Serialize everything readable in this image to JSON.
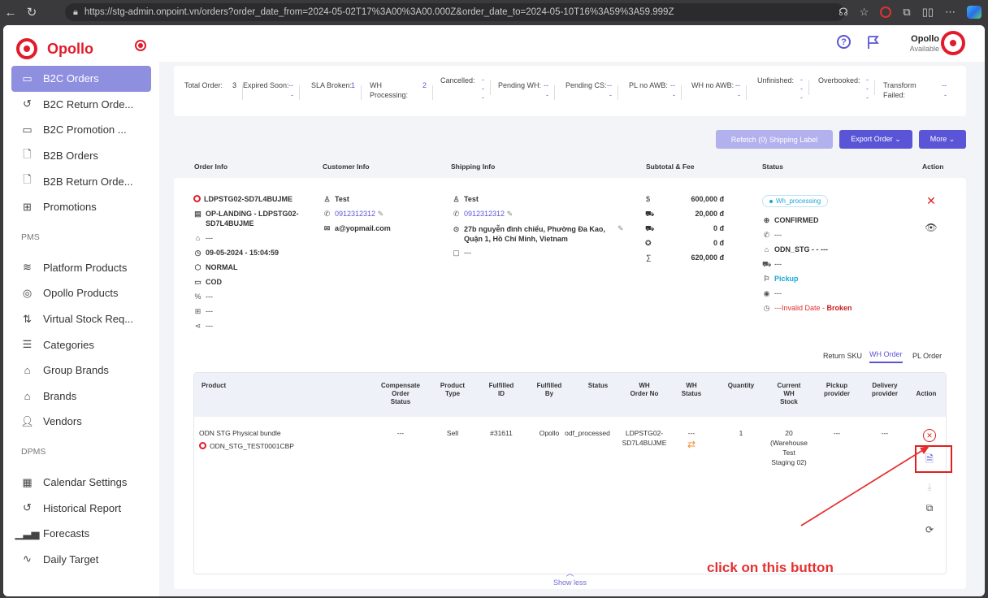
{
  "browser": {
    "url": "https://stg-admin.onpoint.vn/orders?order_date_from=2024-05-02T17%3A00%3A00.000Z&order_date_to=2024-05-10T16%3A59%3A59.999Z"
  },
  "brand": {
    "name": "Opollo"
  },
  "sidebar": {
    "items": [
      {
        "label": "B2C Orders",
        "icon": "orders-icon",
        "active": true
      },
      {
        "label": "B2C Return Orde...",
        "icon": "return-icon"
      },
      {
        "label": "B2C Promotion ...",
        "icon": "promotion-icon"
      },
      {
        "label": "B2B Orders",
        "icon": "document-icon"
      },
      {
        "label": "B2B Return Orde...",
        "icon": "document-icon"
      },
      {
        "label": "Promotions",
        "icon": "table-icon"
      }
    ],
    "pms_label": "PMS",
    "pms_items": [
      {
        "label": "Platform Products",
        "icon": "layers-icon"
      },
      {
        "label": "Opollo Products",
        "icon": "target-icon"
      },
      {
        "label": "Virtual Stock Req...",
        "icon": "flow-icon"
      },
      {
        "label": "Categories",
        "icon": "database-icon"
      },
      {
        "label": "Group Brands",
        "icon": "home-icon"
      },
      {
        "label": "Brands",
        "icon": "home-icon"
      },
      {
        "label": "Vendors",
        "icon": "user-plus-icon"
      }
    ],
    "dpms_label": "DPMS",
    "dpms_items": [
      {
        "label": "Calendar Settings",
        "icon": "calendar-icon"
      },
      {
        "label": "Historical Report",
        "icon": "history-icon"
      },
      {
        "label": "Forecasts",
        "icon": "bar-chart-icon"
      },
      {
        "label": "Daily Target",
        "icon": "activity-icon"
      }
    ]
  },
  "header": {
    "user_name": "Opollo",
    "user_status": "Available"
  },
  "stats": [
    {
      "label": "Total Order:",
      "value": "3",
      "dark": true
    },
    {
      "label": "Expired Soon:",
      "value": "--\n-"
    },
    {
      "label": "SLA Broken:",
      "value": "1"
    },
    {
      "label": "WH Processing:",
      "value": "2"
    },
    {
      "label": "Cancelled:",
      "value": "-\n-\n-"
    },
    {
      "label": "Pending WH:",
      "value": "--\n-"
    },
    {
      "label": "Pending CS:",
      "value": "--\n-"
    },
    {
      "label": "PL no AWB:",
      "value": "--\n-"
    },
    {
      "label": "WH no AWB:",
      "value": "--\n-"
    },
    {
      "label": "Unfinished:",
      "value": "-\n-\n-"
    },
    {
      "label": "Overbooked:",
      "value": "-\n-\n-"
    },
    {
      "label": "Transform Failed:",
      "value": "--\n-"
    }
  ],
  "toolbar": {
    "refetch_label": "Refetch (0) Shipping Label",
    "export_label": "Export Order ⌄",
    "more_label": "More ⌄"
  },
  "columns": {
    "order_info": "Order Info",
    "customer_info": "Customer Info",
    "shipping_info": "Shipping Info",
    "subtotal": "Subtotal & Fee",
    "status": "Status",
    "action": "Action"
  },
  "order": {
    "id": "LDPSTG02-SD7L4BUJME",
    "channel_line1": "OP-LANDING - LDPSTG02-",
    "channel_line2": "SD7L4BUJME",
    "store": "---",
    "date": "09-05-2024 - 15:04:59",
    "type": "NORMAL",
    "payment": "COD",
    "discount": "---",
    "gift": "---",
    "share": "---",
    "customer_name": "Test",
    "customer_phone": "0912312312",
    "customer_email": "a@yopmail.com",
    "shipping_name": "Test",
    "shipping_phone": "0912312312",
    "shipping_address_1": "27b nguyễn đình chiểu, Phường Đa Kao,",
    "shipping_address_2": "Quận 1, Hồ Chí Minh, Vietnam",
    "shipping_note": "---",
    "subtotal": "600,000 đ",
    "shipping_fee": "20,000 đ",
    "fee_2": "0 đ",
    "fee_3": "0 đ",
    "total": "620,000 đ",
    "status_badge": "Wh_processing",
    "status_confirmed": "CONFIRMED",
    "status_line_1": "---",
    "status_wh": "ODN_STG -  - ---",
    "status_line_3": "---",
    "status_pickup": "Pickup",
    "status_line_5": "---",
    "status_invalid": "---Invalid Date - ",
    "status_broken": "Broken"
  },
  "tabs": {
    "return_sku": "Return SKU",
    "wh_order": "WH Order",
    "pl_order": "PL Order"
  },
  "product_table": {
    "headers": {
      "product": "Product",
      "compensate": "Compensate\nOrder\nStatus",
      "ptype": "Product\nType",
      "fulfilled_id": "Fulfilled\nID",
      "fulfilled_by": "Fulfilled\nBy",
      "status": "Status",
      "wh_order_no": "WH\nOrder No",
      "wh_status": "WH\nStatus",
      "quantity": "Quantity",
      "current_stock": "Current\nWH\nStock",
      "pickup": "Pickup\nprovider",
      "delivery": "Delivery\nprovider",
      "action": "Action"
    },
    "row": {
      "product_name": "ODN STG Physical bundle",
      "product_code": "ODN_STG_TEST0001CBP",
      "compensate": "---",
      "ptype": "Sell",
      "fulfilled_id": "#31611",
      "fulfilled_by": "Opollo",
      "status": "odf_processed",
      "wh_order_no": "LDPSTG02-\nSD7L4BUJME",
      "wh_status": "---",
      "quantity": "1",
      "current_stock": "20\n(Warehouse\nTest\nStaging 02)",
      "pickup": "---",
      "delivery": "---"
    }
  },
  "show_less": "Show less",
  "annotation": {
    "text": "click on this button"
  }
}
